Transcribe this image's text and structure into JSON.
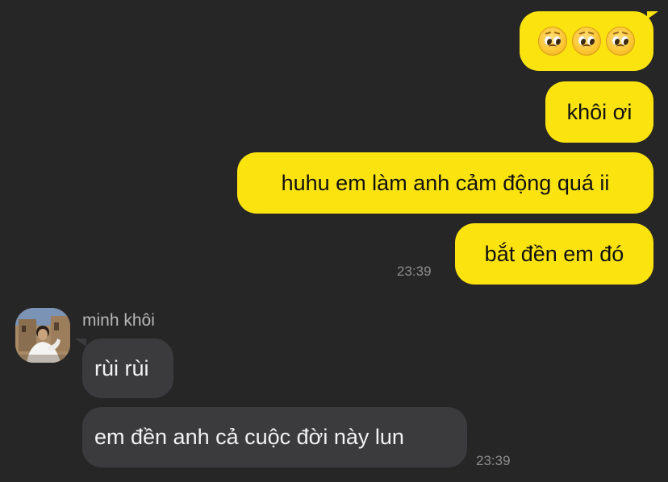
{
  "chat": {
    "outgoing": [
      {
        "type": "emoji",
        "emojis": [
          "pleading-face-icon",
          "pleading-face-icon",
          "pleading-face-icon"
        ]
      },
      {
        "type": "text",
        "text": "khôi ơi"
      },
      {
        "type": "text",
        "text": "huhu em làm anh cảm động quá ii"
      },
      {
        "type": "text",
        "text": "bắt đền em đó"
      }
    ],
    "outgoing_time": "23:39",
    "contact": {
      "name": "minh khôi",
      "avatar_icon": "contact-avatar-photo"
    },
    "incoming": [
      {
        "text": "rùi rùi"
      },
      {
        "text": "em đền anh cả cuộc đời này lun"
      }
    ],
    "incoming_time": "23:39"
  },
  "colors": {
    "background": "#262626",
    "outgoing_bubble": "#fbe30f",
    "incoming_bubble": "#3b3b3e",
    "timestamp": "#8d8d8d"
  }
}
